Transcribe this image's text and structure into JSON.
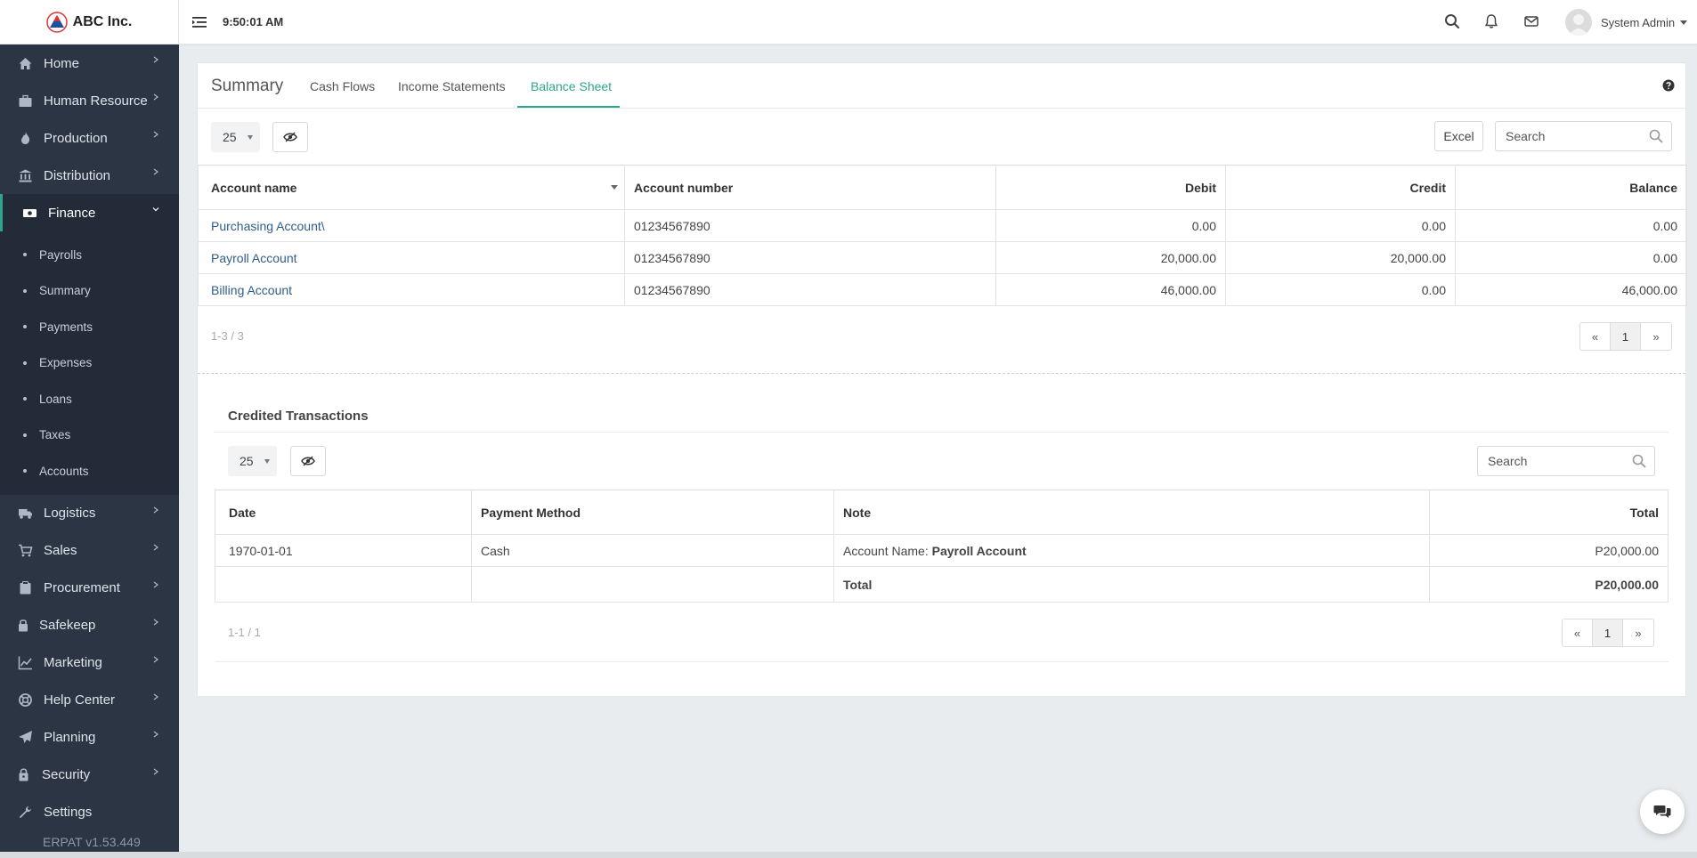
{
  "brand": {
    "name": "ABC Inc."
  },
  "topbar": {
    "time": "9:50:01 AM",
    "user_name": "System Admin"
  },
  "sidebar": {
    "items": [
      {
        "label": "Home",
        "icon": "home-icon"
      },
      {
        "label": "Human Resource",
        "icon": "briefcase-icon"
      },
      {
        "label": "Production",
        "icon": "flame-icon"
      },
      {
        "label": "Distribution",
        "icon": "bank-icon"
      },
      {
        "label": "Finance",
        "icon": "money-icon"
      },
      {
        "label": "Logistics",
        "icon": "truck-icon"
      },
      {
        "label": "Sales",
        "icon": "cart-icon"
      },
      {
        "label": "Procurement",
        "icon": "clipboard-icon"
      },
      {
        "label": "Safekeep",
        "icon": "lock-icon"
      },
      {
        "label": "Marketing",
        "icon": "chart-line-icon"
      },
      {
        "label": "Help Center",
        "icon": "lifebuoy-icon"
      },
      {
        "label": "Planning",
        "icon": "paper-plane-icon"
      },
      {
        "label": "Security",
        "icon": "shield-lock-icon"
      },
      {
        "label": "Settings",
        "icon": "wrench-icon"
      }
    ],
    "finance_sub": [
      "Payrolls",
      "Summary",
      "Payments",
      "Expenses",
      "Loans",
      "Taxes",
      "Accounts"
    ],
    "version": "ERPAT v1.53.449"
  },
  "tabs": {
    "title": "Summary",
    "items": [
      "Cash Flows",
      "Income Statements",
      "Balance Sheet"
    ],
    "active": "Balance Sheet"
  },
  "balance": {
    "page_length": "25",
    "excel_label": "Excel",
    "search_placeholder": "Search",
    "columns": [
      "Account name",
      "Account number",
      "Debit",
      "Credit",
      "Balance"
    ],
    "rows": [
      [
        "Purchasing Account\\",
        "01234567890",
        "0.00",
        "0.00",
        "0.00"
      ],
      [
        "Payroll Account",
        "01234567890",
        "20,000.00",
        "20,000.00",
        "0.00"
      ],
      [
        "Billing Account",
        "01234567890",
        "46,000.00",
        "0.00",
        "46,000.00"
      ]
    ],
    "info": "1-3 / 3",
    "pager": {
      "prev": "«",
      "page": "1",
      "next": "»"
    }
  },
  "credited": {
    "title": "Credited Transactions",
    "page_length": "25",
    "search_placeholder": "Search",
    "columns": [
      "Date",
      "Payment Method",
      "Note",
      "Total"
    ],
    "rows": [
      {
        "date": "1970-01-01",
        "method": "Cash",
        "note_prefix": "Account Name: ",
        "note_value": "Payroll Account",
        "total": "P20,000.00"
      }
    ],
    "footer": {
      "label": "Total",
      "total": "P20,000.00"
    },
    "info": "1-1 / 1",
    "pager": {
      "prev": "«",
      "page": "1",
      "next": "»"
    }
  },
  "colors": {
    "accent": "#2ea58b",
    "sidebar": "#2b3544",
    "sidebar_active": "#222b37",
    "link": "#2f5d8a"
  }
}
